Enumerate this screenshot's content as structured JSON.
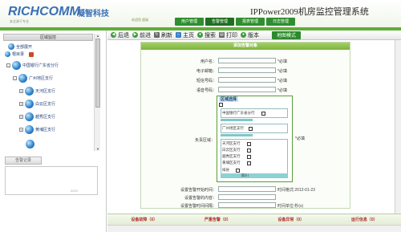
{
  "header": {
    "logo_en": "RICHCOMM",
    "logo_cn": "凝智科技",
    "slogan": "安全源于专业",
    "welcome": "欢迎您  超级",
    "title": "IPPower2009机房监控管理系统",
    "nav": [
      "用户管理",
      "告警管理",
      "报表管理",
      "日志管理"
    ]
  },
  "sidebar": {
    "title": "区域监控",
    "tree": [
      {
        "label": "全部展开",
        "level": 0,
        "expand": ""
      },
      {
        "label": "根目录",
        "level": 0,
        "expand": ""
      },
      {
        "label": "中国银行广东省分行",
        "level": 1,
        "expand": "-"
      },
      {
        "label": "广州地区支行",
        "level": 2,
        "expand": "-"
      },
      {
        "label": "天河区支行",
        "level": 3,
        "expand": "+"
      },
      {
        "label": "白云区支行",
        "level": 3,
        "expand": "+"
      },
      {
        "label": "越秀区支行",
        "level": 3,
        "expand": "+"
      },
      {
        "label": "黄埔区支行",
        "level": 3,
        "expand": "+"
      }
    ],
    "alarm_button": "告警记录",
    "alarm_footer": "0/0/0"
  },
  "toolbar": {
    "back": "后退",
    "forward": "前进",
    "refresh": "刷新",
    "home": "主页",
    "search": "搜索",
    "print": "打印",
    "version": "版本",
    "map_mode": "地图模式"
  },
  "form": {
    "title": "添加告警对象",
    "fields": [
      {
        "label": "用户名：",
        "required": "*必填"
      },
      {
        "label": "电子邮箱：",
        "required": "*必填"
      },
      {
        "label": "短信号码：",
        "required": "*必填"
      },
      {
        "label": "语音号码：",
        "required": "*必填"
      }
    ],
    "region_label": "负责区域：",
    "region_required": "*必填",
    "region_box": {
      "title": "区域选择",
      "items": [
        "中国银行广东省分行",
        "广州地区支行",
        "天河区支行",
        "白云区支行",
        "越秀区支行",
        "黄埔区支行",
        "排县",
        "四川"
      ]
    },
    "start_time_label": "设置告警开始时间：",
    "start_time_hint": "时间格式:2012-01-23",
    "content_label": "设置告警的内容：",
    "interval_label": "设置告警时间间隔：",
    "interval_hint": "时间单位:秒(s)"
  },
  "status": {
    "items": [
      "设备故障（0）",
      "严重告警（0）",
      "设备异常（0）",
      "运行信息（0）"
    ]
  }
}
